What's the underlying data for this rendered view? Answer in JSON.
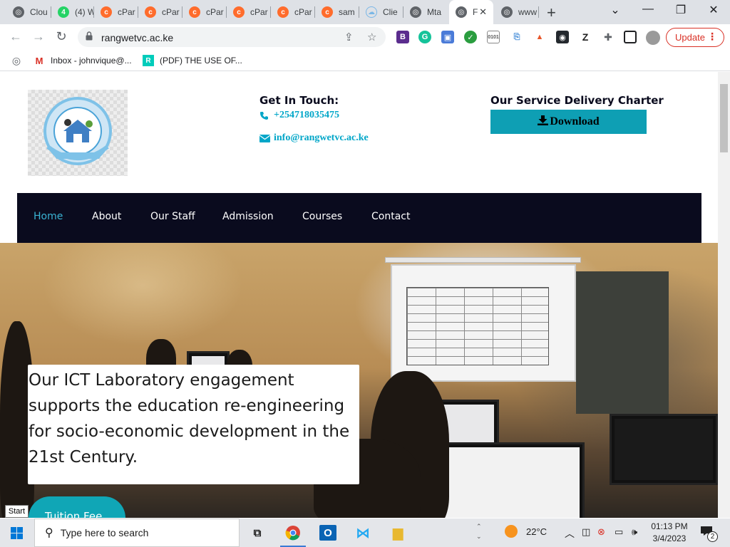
{
  "browser": {
    "tabs": [
      {
        "title": "Clou",
        "icon": "globe-icon"
      },
      {
        "title": "(4) W",
        "icon": "whatsapp-icon",
        "color": "#25d366"
      },
      {
        "title": "cPar",
        "icon": "cpanel-icon",
        "color": "#ff6c2c"
      },
      {
        "title": "cPar",
        "icon": "cpanel-icon",
        "color": "#ff6c2c"
      },
      {
        "title": "cPar",
        "icon": "cpanel-icon",
        "color": "#ff6c2c"
      },
      {
        "title": "cPar",
        "icon": "cpanel-icon",
        "color": "#ff6c2c"
      },
      {
        "title": "cPar",
        "icon": "cpanel-icon",
        "color": "#ff6c2c"
      },
      {
        "title": "sam",
        "icon": "cpanel-icon",
        "color": "#ff6c2c"
      },
      {
        "title": "Clie",
        "icon": "cloud-icon"
      },
      {
        "title": "Mta",
        "icon": "globe-icon"
      },
      {
        "title": "F",
        "icon": "globe-icon",
        "active": true
      },
      {
        "title": "www",
        "icon": "globe-icon"
      }
    ],
    "new_tab": "+",
    "url": "rangwetvc.ac.ke",
    "update_label": "Update",
    "bookmarks": [
      {
        "label": "",
        "icon": "globe-icon"
      },
      {
        "label": "Inbox - johnvique@...",
        "icon": "gmail-icon"
      },
      {
        "label": "(PDF) THE USE OF...",
        "icon": "researchgate-icon"
      }
    ]
  },
  "site": {
    "logo_alt": "Rangwe Technical and Vocational College logo",
    "contact": {
      "title": "Get In Touch:",
      "phone": "+254718035475",
      "email": "info@rangwetvc.ac.ke"
    },
    "charter": {
      "title": "Our Service Delivery Charter",
      "download_label": "Download"
    },
    "nav": [
      "Home",
      "About",
      "Our Staff",
      "Admission",
      "Courses",
      "Contact"
    ],
    "active_nav": "Home",
    "hero": {
      "caption": "Our ICT Laboratory engagement supports the education re-engineering for socio-economic development in the 21st Century.",
      "button": "Tuition Fee"
    }
  },
  "taskbar": {
    "start_tooltip": "Start",
    "search_placeholder": "Type here to search",
    "weather": "22°C",
    "time": "01:13 PM",
    "date": "3/4/2023",
    "notifications": "2"
  },
  "colors": {
    "nav_bg": "#0a0b1e",
    "accent": "#00a6c8",
    "download_bg": "#0e9fb4",
    "tuition_bg": "#10a6b6"
  }
}
